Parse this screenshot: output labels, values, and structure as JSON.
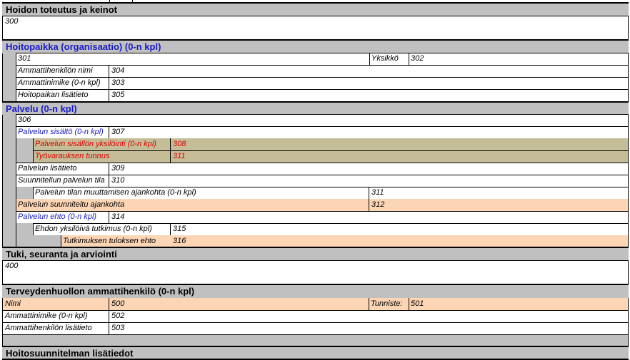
{
  "sections": {
    "hoidon_toteutus": {
      "title": "Hoidon toteutus ja keinot",
      "code": "300"
    },
    "hoitopaikka": {
      "title": "Hoitopaikka (organisaatio) (0-n kpl)",
      "code": "301",
      "yksikko_label": "Yksikkö",
      "yksikko_code": "302",
      "rows": [
        {
          "label": "Ammattihenkilön nimi",
          "code": "304"
        },
        {
          "label": "Ammattinimike (0-n kpl)",
          "code": "303"
        },
        {
          "label": "Hoitopaikan lisätieto",
          "code": "305"
        }
      ]
    },
    "palvelu": {
      "title": "Palvelu (0-n kpl)",
      "code": "306",
      "sisalto_label": "Palvelun sisältö (0-n kpl)",
      "sisalto_code": "307",
      "yksilointi_label": "Palvelun sisällön yksilöinti (0-n kpl)",
      "yksilointi_code": "308",
      "tyovaraus_label": "Työvarauksen tunnus",
      "tyovaraus_code": "311",
      "lisatieto_label": "Palvelun lisätieto",
      "lisatieto_code": "309",
      "tila_label": "Suunnitellun palvelun tila",
      "tila_code": "310",
      "tila_aika_label": "Palvelun tilan muuttamisen ajankohta (0-n kpl)",
      "tila_aika_code": "311",
      "suunniteltu_label": "Palvelun suunniteltu ajankohta",
      "suunniteltu_code": "312",
      "ehto_label": "Palvelun ehto (0-n kpl)",
      "ehto_code": "314",
      "ehto_tutkimus_label": "Ehdon yksilöivä tutkimus (0-n kpl)",
      "ehto_tutkimus_code": "315",
      "tulos_label": "Tutkimuksen tuloksen ehto",
      "tulos_code": "316"
    },
    "tuki": {
      "title": "Tuki, seuranta ja arviointi",
      "code": "400"
    },
    "terveydenhuolto": {
      "title": "Terveydenhuollon ammattihenkilö (0-n kpl)",
      "nimi_label": "Nimi",
      "nimi_code": "500",
      "tunniste_label": "Tunniste:",
      "tunniste_code": "501",
      "rows": [
        {
          "label": "Ammattinimike (0-n kpl)",
          "code": "502"
        },
        {
          "label": "Ammattihenkilön lisätieto",
          "code": "503"
        }
      ]
    },
    "lisatiedot": {
      "title": "Hoitosuunnitelman lisätiedot"
    }
  },
  "colors": {
    "gray": "#c0c0c0",
    "tan": "#c4bd97",
    "peach": "#fcd5b4",
    "blue": "#1a1acc",
    "red": "#e00000"
  }
}
